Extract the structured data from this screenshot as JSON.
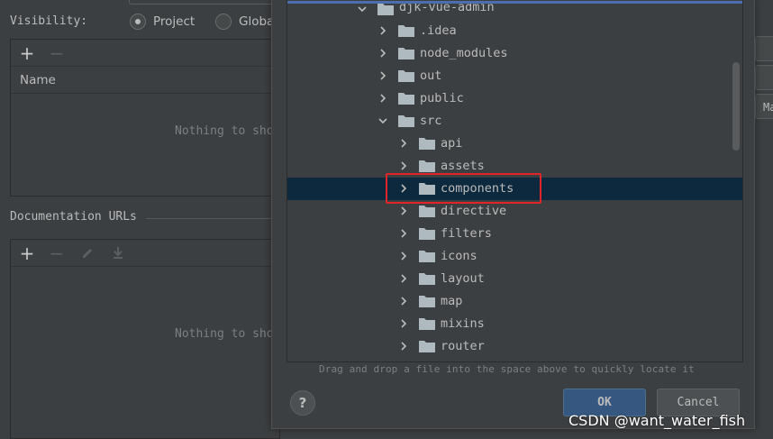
{
  "settings": {
    "visibility_label": "Visibility:",
    "visibility_options": [
      {
        "label": "Project",
        "selected": true
      },
      {
        "label": "Globa",
        "selected": false
      }
    ],
    "classes_table": {
      "add_label": "+",
      "remove_label": "−",
      "column_name": "Name",
      "empty_text": "Nothing to sho"
    },
    "documentation": {
      "title": "Documentation URLs",
      "add_label": "+",
      "remove_label": "−",
      "empty_text": "Nothing to sho"
    },
    "right_strip_text": "Ma"
  },
  "dialog": {
    "tree": [
      {
        "label": "djk-vue-admin",
        "expanded": true,
        "level": 0
      },
      {
        "label": ".idea",
        "expanded": false,
        "level": 1
      },
      {
        "label": "node_modules",
        "expanded": false,
        "level": 1
      },
      {
        "label": "out",
        "expanded": false,
        "level": 1
      },
      {
        "label": "public",
        "expanded": false,
        "level": 1
      },
      {
        "label": "src",
        "expanded": true,
        "level": 1
      },
      {
        "label": "api",
        "expanded": false,
        "level": 2
      },
      {
        "label": "assets",
        "expanded": false,
        "level": 2
      },
      {
        "label": "components",
        "expanded": false,
        "level": 2,
        "selected": true
      },
      {
        "label": "directive",
        "expanded": false,
        "level": 2
      },
      {
        "label": "filters",
        "expanded": false,
        "level": 2
      },
      {
        "label": "icons",
        "expanded": false,
        "level": 2
      },
      {
        "label": "layout",
        "expanded": false,
        "level": 2
      },
      {
        "label": "map",
        "expanded": false,
        "level": 2
      },
      {
        "label": "mixins",
        "expanded": false,
        "level": 2
      },
      {
        "label": "router",
        "expanded": false,
        "level": 2
      }
    ],
    "drag_hint": "Drag and drop a file into the space above to quickly locate it",
    "help_label": "?",
    "ok_label": "OK",
    "cancel_label": "Cancel"
  },
  "watermark": "CSDN @want_water_fish",
  "colors": {
    "background": "#3c3f41",
    "selection": "#0d293e",
    "folder": "#aeb9c0",
    "highlight_box": "#e0242a",
    "ok_button": "#365880"
  }
}
